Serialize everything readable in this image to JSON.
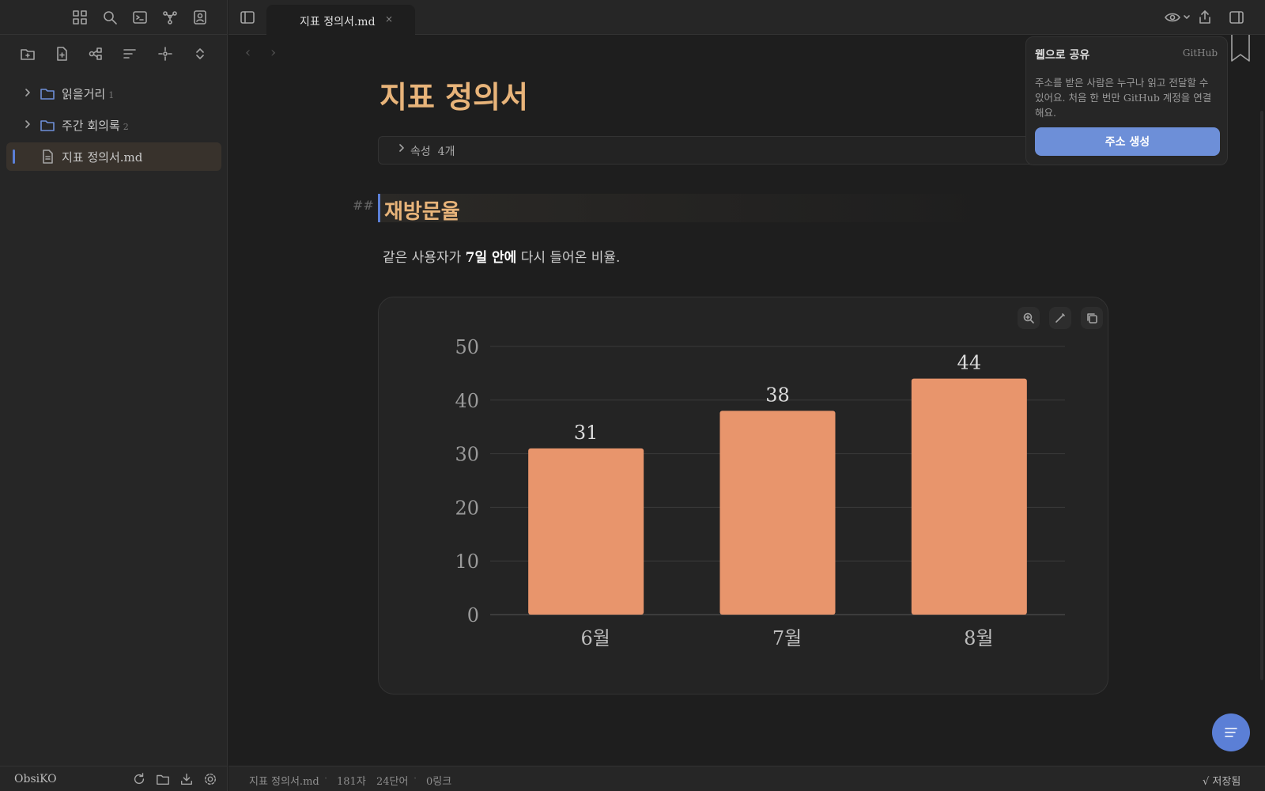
{
  "sidebar": {
    "ribbon_icons": [
      "layout-grid-icon",
      "search-icon",
      "terminal-icon",
      "graph-icon",
      "contact-icon"
    ],
    "toolbar_icons": [
      "new-folder-icon",
      "new-file-icon",
      "graph-view-icon",
      "sort-icon",
      "focus-icon",
      "expand-collapse-icon"
    ],
    "items": [
      {
        "label": "읽을거리",
        "count": "1",
        "type": "folder"
      },
      {
        "label": "주간 회의록",
        "count": "2",
        "type": "folder"
      },
      {
        "label": "지표 정의서.md",
        "type": "file",
        "active": true
      }
    ],
    "vault_name": "ObsiKO",
    "footer_icons": [
      "refresh-icon",
      "folder-icon",
      "download-icon",
      "settings-icon"
    ]
  },
  "tabbar": {
    "active_tab": "지표 정의서.md",
    "close_glyph": "×"
  },
  "editor": {
    "title": "지표 정의서",
    "properties_label": "속성  4개",
    "heading_marker": "##",
    "heading": "재방문율",
    "paragraph": {
      "before": "같은 사용자가 ",
      "bold": "7일 안에",
      "after": " 다시 들어온 비율."
    }
  },
  "chart_data": {
    "type": "bar",
    "categories": [
      "6월",
      "7월",
      "8월"
    ],
    "values": [
      31,
      38,
      44
    ],
    "data_labels": [
      "31",
      "38",
      "44"
    ],
    "yticks": [
      0,
      10,
      20,
      30,
      40,
      50
    ],
    "ylim": [
      0,
      50
    ],
    "grid": true,
    "bar_color": "#e8956c"
  },
  "share_popup": {
    "title": "웹으로 공유",
    "provider": "GitHub",
    "description": "주소를 받은 사람은 누구나 읽고 전달할 수 있어요. 처음 한 번만 GitHub 계정을 연결해요.",
    "button_label": "주소 생성"
  },
  "statusbar": {
    "file": "지표 정의서.md",
    "chars": "181자",
    "words": "24단어",
    "links": "0링크",
    "saved": "√ 저장됨"
  },
  "colors": {
    "accent": "#5b7fd6",
    "heading": "#e8b47a",
    "bar": "#e8956c"
  }
}
